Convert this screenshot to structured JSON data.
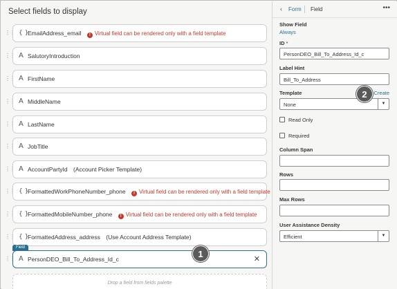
{
  "left_panel": {
    "title": "Select fields to display",
    "fields": [
      {
        "icon": "brace",
        "name": "EmailAddress_email",
        "warning": "Virtual field can be rendered only with a field template",
        "note": ""
      },
      {
        "icon": "text",
        "name": "SalutoryIntroduction",
        "warning": "",
        "note": ""
      },
      {
        "icon": "text",
        "name": "FirstName",
        "warning": "",
        "note": ""
      },
      {
        "icon": "text",
        "name": "MiddleName",
        "warning": "",
        "note": ""
      },
      {
        "icon": "text",
        "name": "LastName",
        "warning": "",
        "note": ""
      },
      {
        "icon": "text",
        "name": "JobTitle",
        "warning": "",
        "note": ""
      },
      {
        "icon": "text",
        "name": "AccountPartyId",
        "warning": "",
        "note": "(Account Picker Template)"
      },
      {
        "icon": "brace",
        "name": "FormattedWorkPhoneNumber_phone",
        "warning": "Virtual field can be rendered only with a field template",
        "note": ""
      },
      {
        "icon": "brace",
        "name": "FormattedMobileNumber_phone",
        "warning": "Virtual field can be rendered only with a field template",
        "note": ""
      },
      {
        "icon": "brace",
        "name": "FormattedAddress_address",
        "warning": "",
        "note": "(Use Account Address Template)"
      }
    ],
    "selected_tag": "Field",
    "selected_field": "PersonDEO_Bill_To_Address_Id_c",
    "drop_hint": "Drop a field from fields palette",
    "callout_1": "1"
  },
  "right_panel": {
    "breadcrumb": "Form",
    "current": "Field",
    "show_field_label": "Show Field",
    "show_field_value": "Always",
    "id_label": "ID",
    "id_required": "*",
    "id_value": "PersonDEO_Bill_To_Address_Id_c",
    "label_hint_label": "Label Hint",
    "label_hint_value": "Bill_To_Address",
    "template_label": "Template",
    "template_create": "Create",
    "template_value": "None",
    "callout_2": "2",
    "read_only_label": "Read Only",
    "required_label": "Required",
    "column_span_label": "Column Span",
    "column_span_value": "",
    "rows_label": "Rows",
    "rows_value": "",
    "max_rows_label": "Max Rows",
    "max_rows_value": "",
    "density_label": "User Assistance Density",
    "density_value": "Efficient"
  },
  "colors": {
    "accent": "#2c6e8f",
    "warning": "#c0392b",
    "callout": "#5a5a5a"
  }
}
